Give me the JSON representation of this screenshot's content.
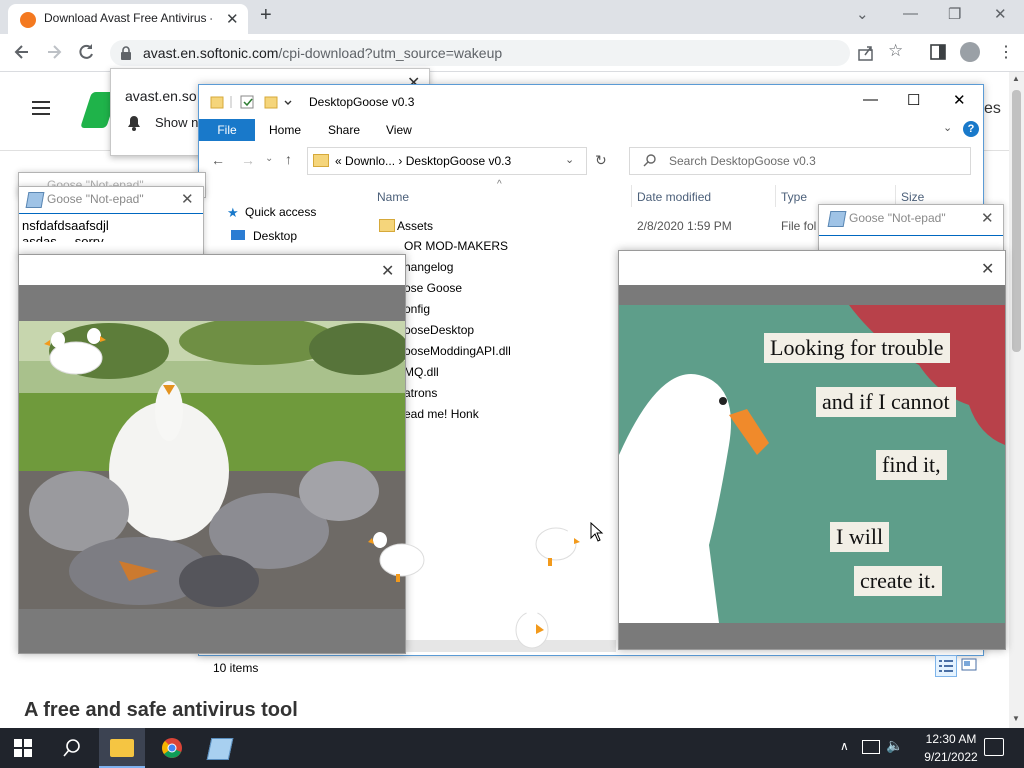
{
  "browser": {
    "tab_title": "Download Avast Free Antivirus -",
    "url_host": "avast.en.softonic.com",
    "url_path": "/cpi-download?utm_source=wakeup"
  },
  "notification": {
    "site": "avast.en.so",
    "text": "Show no"
  },
  "page": {
    "heading": "A free and safe antivirus tool",
    "right_fragment": "es"
  },
  "explorer": {
    "title": "DesktopGoose v0.3",
    "ribbon_file": "File",
    "ribbon_tabs": [
      "Home",
      "Share",
      "View"
    ],
    "help": "?",
    "breadcrumb_root": "«",
    "breadcrumb_parent": "Downlo...",
    "breadcrumb_sep": "›",
    "breadcrumb_current": "DesktopGoose v0.3",
    "search_placeholder": "Search DesktopGoose v0.3",
    "nav_quick_access": "Quick access",
    "nav_desktop": "Desktop",
    "columns": {
      "name": "Name",
      "date": "Date modified",
      "type": "Type",
      "size": "Size"
    },
    "first_row": {
      "name": "Assets",
      "date": "2/8/2020 1:59 PM",
      "type": "File fol"
    },
    "rows": [
      "OR MOD-MAKERS",
      "hangelog",
      "ose Goose",
      "onfig",
      "ooseDesktop",
      "ooseModdingAPI.dll",
      "MQ.dll",
      "atrons",
      "ead me! Honk"
    ],
    "status": "10 items"
  },
  "goose_notepads": {
    "title": "Goose \"Not-epad\"",
    "text_line1": "nsfdafdsaafsdjl",
    "text_line2": "asdas ... sorry"
  },
  "meme": {
    "lines": [
      "Looking for trouble",
      "and if I cannot",
      "find it,",
      "I will",
      "create it."
    ]
  },
  "taskbar": {
    "time": "12:30 AM",
    "date": "9/21/2022"
  },
  "colors": {
    "explorer_accent": "#1979ca",
    "taskbar": "#20242c",
    "meme_background": "#5e9e8a",
    "grass": "#6f9a3c"
  }
}
